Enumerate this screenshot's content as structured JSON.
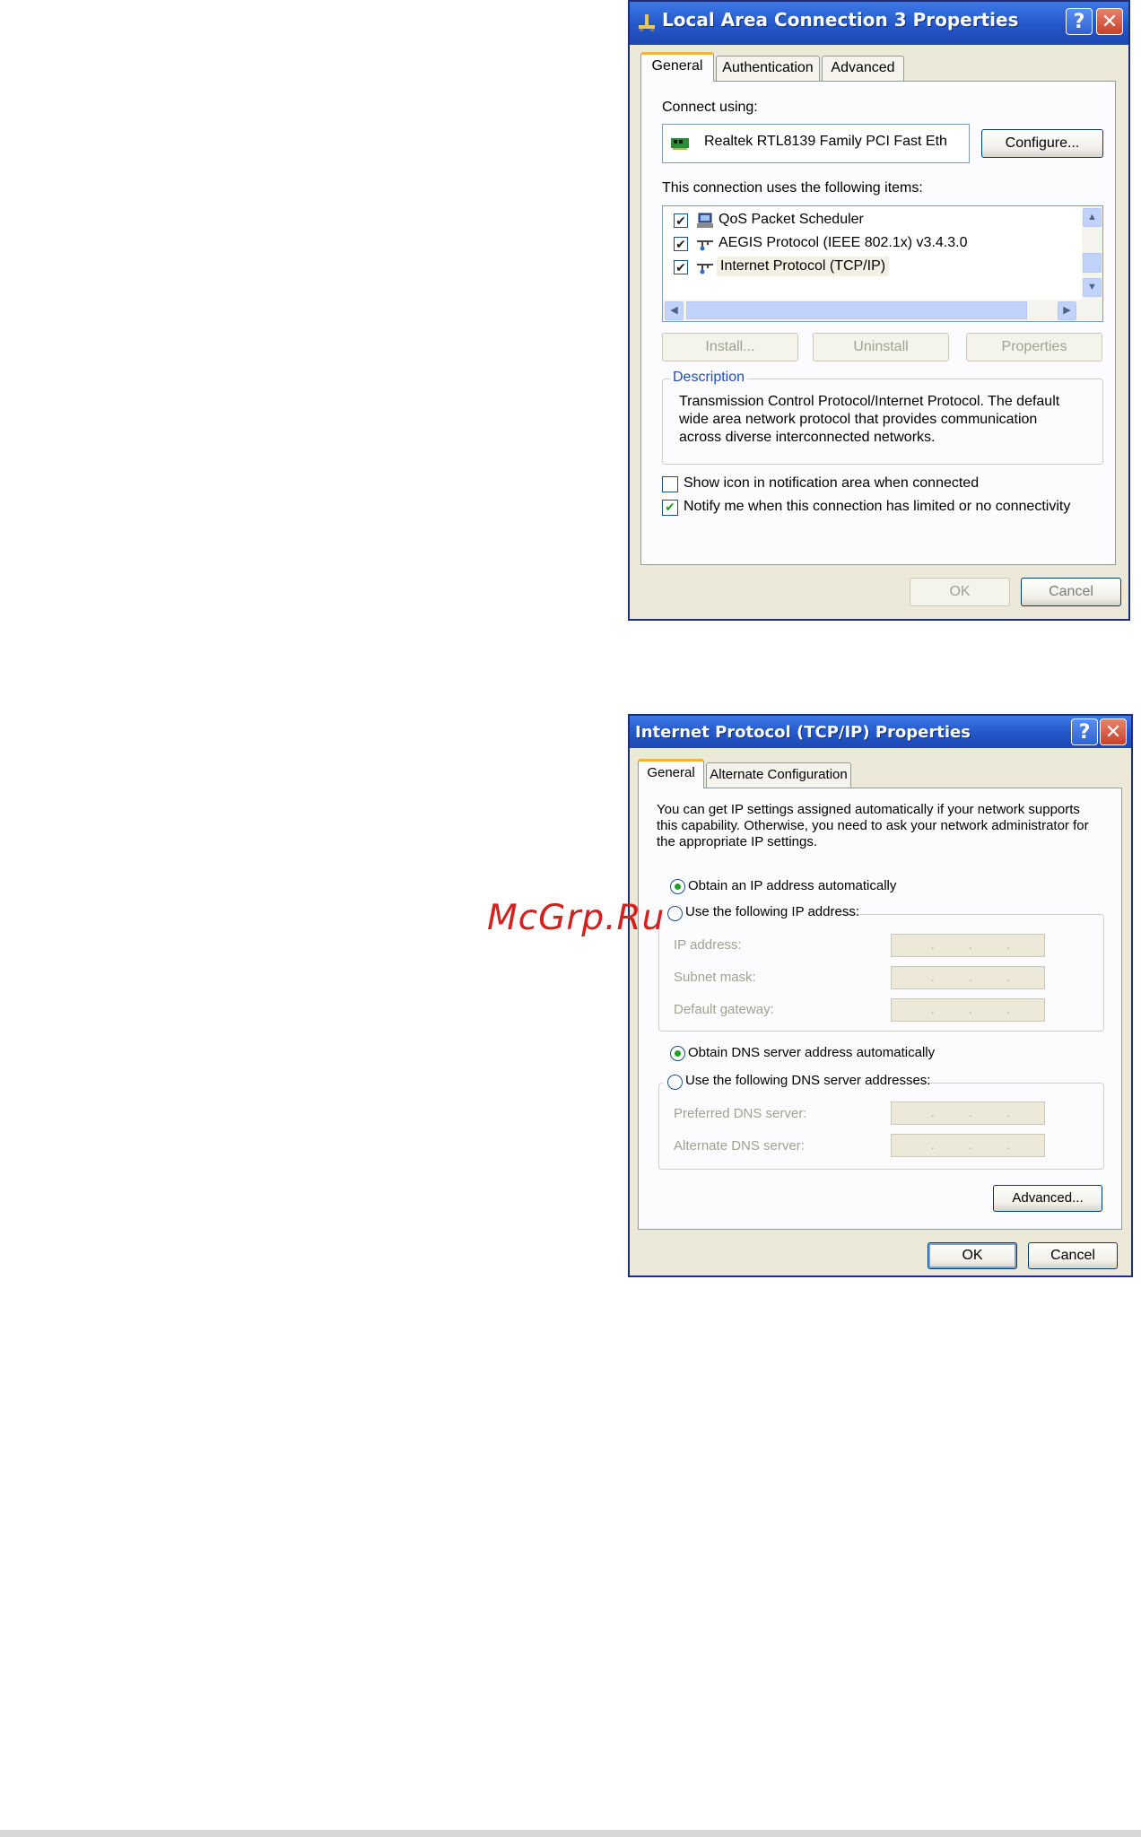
{
  "dialog1": {
    "title": "Local Area Connection 3 Properties",
    "tabs": [
      "General",
      "Authentication",
      "Advanced"
    ],
    "connect_using_label": "Connect using:",
    "adapter_name": "Realtek RTL8139 Family PCI Fast Eth",
    "configure_button": "Configure...",
    "items_label": "This connection uses the following items:",
    "items": [
      {
        "label": "QoS Packet Scheduler",
        "checked": true,
        "icon": "scheduler-icon"
      },
      {
        "label": "AEGIS Protocol (IEEE 802.1x) v3.4.3.0",
        "checked": true,
        "icon": "network-protocol-icon"
      },
      {
        "label": "Internet Protocol (TCP/IP)",
        "checked": true,
        "icon": "network-protocol-icon",
        "selected": true
      }
    ],
    "install_button": "Install...",
    "uninstall_button": "Uninstall",
    "properties_button": "Properties",
    "description_legend": "Description",
    "description_lines": [
      "Transmission Control Protocol/Internet Protocol. The default",
      "wide area network protocol that provides communication",
      "across diverse interconnected networks."
    ],
    "show_icon_label": "Show icon in notification area when connected",
    "show_icon_checked": false,
    "notify_label": "Notify me when this connection has limited or no connectivity",
    "notify_checked": true,
    "ok_button": "OK",
    "cancel_button": "Cancel"
  },
  "dialog2": {
    "title": "Internet Protocol (TCP/IP) Properties",
    "tabs": [
      "General",
      "Alternate Configuration"
    ],
    "intro_lines": [
      "You can get IP settings assigned automatically if your network supports",
      "this capability. Otherwise, you need to ask your network administrator for",
      "the appropriate IP settings."
    ],
    "obtain_ip_auto": "Obtain an IP address automatically",
    "use_following_ip": "Use the following IP address:",
    "ip_address_label": "IP address:",
    "subnet_mask_label": "Subnet mask:",
    "default_gateway_label": "Default gateway:",
    "obtain_dns_auto": "Obtain DNS server address automatically",
    "use_following_dns": "Use the following DNS server addresses:",
    "preferred_dns_label": "Preferred DNS server:",
    "alternate_dns_label": "Alternate DNS server:",
    "advanced_button": "Advanced...",
    "ok_button": "OK",
    "cancel_button": "Cancel",
    "help_glyph": "?",
    "close_glyph": "✕"
  },
  "watermark": "McGrp.Ru",
  "colors": {
    "titlebar_blue": "#2357c9",
    "dialog_face": "#ece9d8",
    "check_green": "#21a121",
    "tab_highlight": "#f0b43c",
    "watermark_red": "#d4201f"
  }
}
